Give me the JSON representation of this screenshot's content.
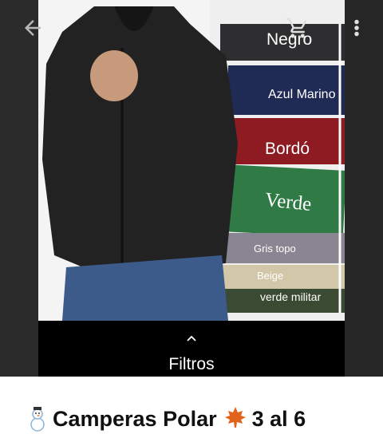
{
  "appbar": {
    "back_icon": "arrow-back-icon",
    "cart_icon": "shopping-cart-icon",
    "more_icon": "more-vert-icon"
  },
  "product_image": {
    "color_labels": [
      "Negro",
      "Azul Marino",
      "Bordó",
      "Verde",
      "Gris topo",
      "Beige",
      "verde militar"
    ]
  },
  "filters": {
    "chevron_icon": "chevron-up-icon",
    "label": "Filtros"
  },
  "title": {
    "prefix_icon": "snowman-emoji",
    "text": "Camperas Polar",
    "mid_icon": "maple-leaf-emoji",
    "suffix": "3 al 6"
  },
  "colors": {
    "negro": "#2a2a2a",
    "azul_marino": "#1f2a55",
    "bordo": "#8e1a22",
    "verde": "#2f7a45",
    "gris_topo": "#8a8593",
    "beige": "#d2c7a8",
    "verde_militar": "#3b4a33"
  }
}
